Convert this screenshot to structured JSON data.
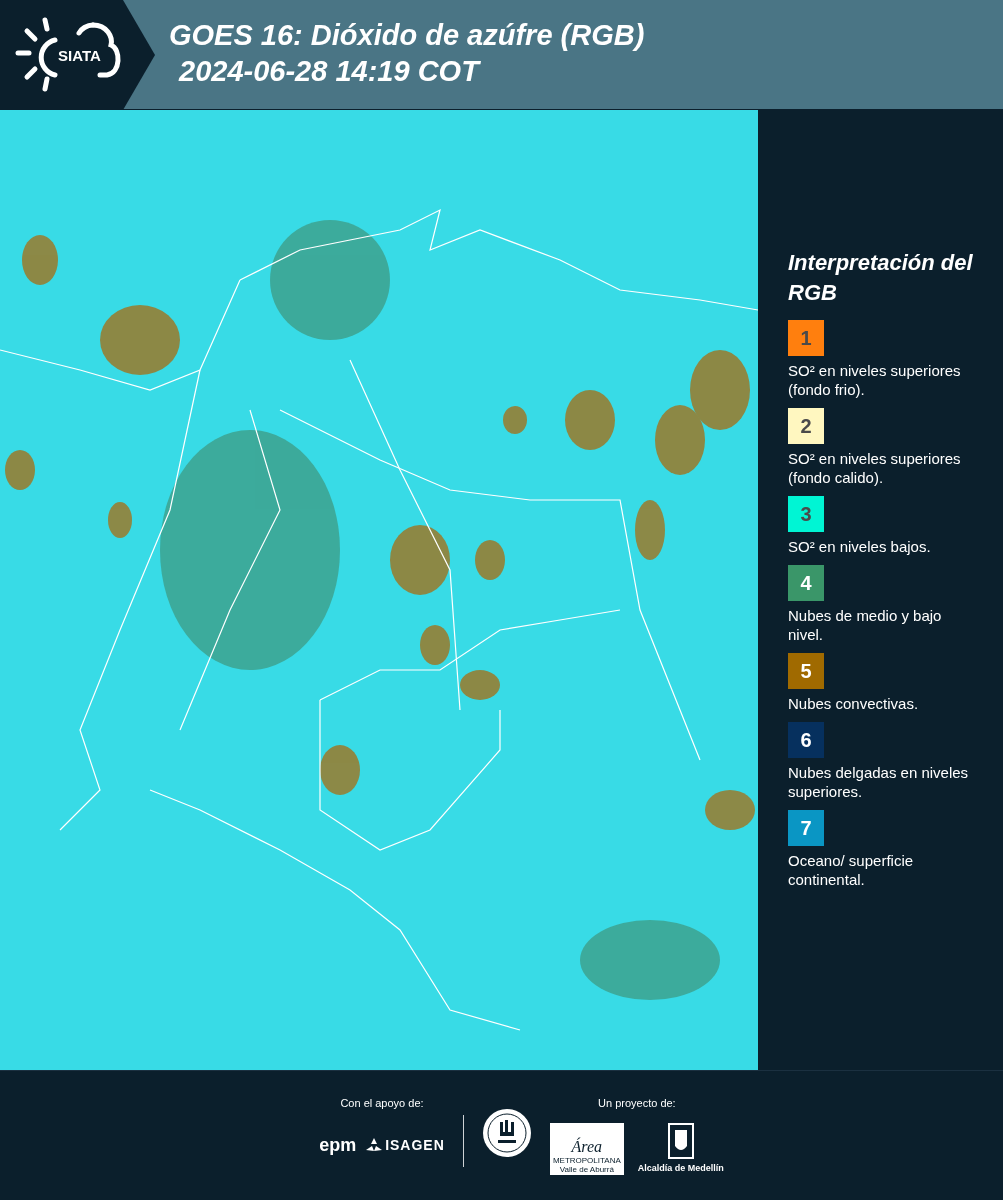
{
  "header": {
    "logo_text": "SIATA",
    "title": "GOES 16: Dióxido de azúfre (RGB)",
    "timestamp": "2024-06-28 14:19 COT"
  },
  "legend": {
    "title": "Interpretación del RGB",
    "items": [
      {
        "number": "1",
        "color": "#ff7f0e",
        "label": "SO² en niveles superiores (fondo frio)."
      },
      {
        "number": "2",
        "color": "#fff7c0",
        "label": "SO² en niveles superiores (fondo calido)."
      },
      {
        "number": "3",
        "color": "#00f5d4",
        "label": "SO² en niveles bajos."
      },
      {
        "number": "4",
        "color": "#3a9669",
        "label": "Nubes de medio y bajo nivel."
      },
      {
        "number": "5",
        "color": "#a06a00",
        "label": "Nubes convectivas."
      },
      {
        "number": "6",
        "color": "#06305e",
        "label": "Nubes delgadas en niveles superiores."
      },
      {
        "number": "7",
        "color": "#0a96c4",
        "label": "Oceano/ superficie continental."
      }
    ]
  },
  "footer": {
    "support_label": "Con el apoyo de:",
    "project_label": "Un proyecto de:",
    "epm": "epm",
    "isagen": "ISAGEN",
    "area": "Área",
    "area_sub": "METROPOLITANA",
    "area_sub2": "Valle de Aburrá",
    "alcaldia": "Alcaldía de Medellín"
  }
}
